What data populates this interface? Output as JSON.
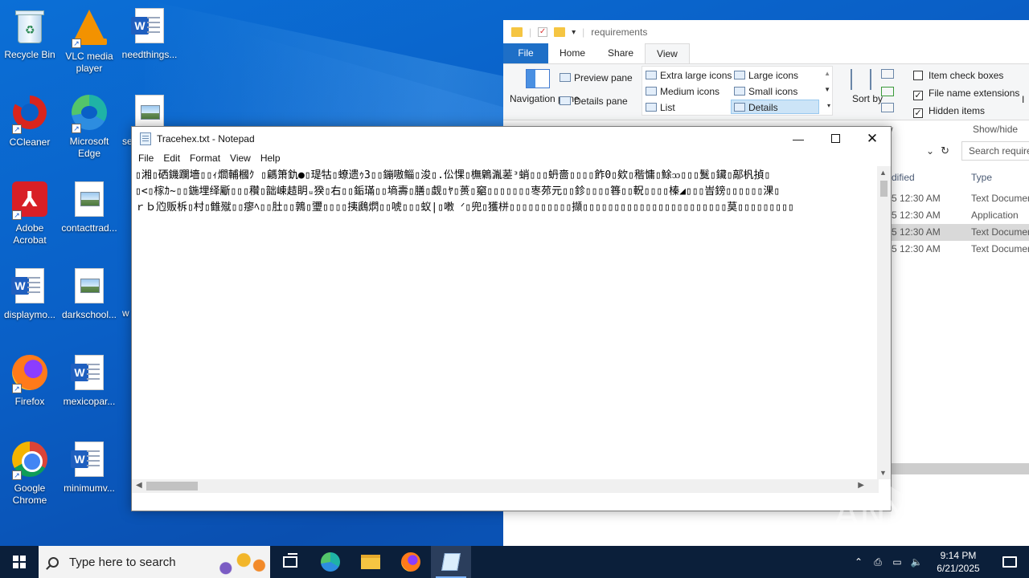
{
  "desktop": {
    "icons": [
      {
        "label": "Recycle Bin"
      },
      {
        "label": "VLC media player"
      },
      {
        "label": "needthings..."
      },
      {
        "label": "CCleaner"
      },
      {
        "label": "Microsoft Edge"
      },
      {
        "label": "se"
      },
      {
        "label": "Adobe Acrobat"
      },
      {
        "label": "contacttrad..."
      },
      {
        "label": "displaymo..."
      },
      {
        "label": "darkschool..."
      },
      {
        "label": "w"
      },
      {
        "label": "Firefox"
      },
      {
        "label": "mexicopar..."
      },
      {
        "label": "Google Chrome"
      },
      {
        "label": "minimumv..."
      }
    ]
  },
  "explorer": {
    "title": "requirements",
    "tabs": [
      "File",
      "Home",
      "Share",
      "View"
    ],
    "ribbon": {
      "navigation_pane": "Navigation pane",
      "preview_pane": "Preview pane",
      "details_pane": "Details pane",
      "layout": [
        "Extra large icons",
        "Large icons",
        "Medium icons",
        "Small icons",
        "List",
        "Details"
      ],
      "sort_by": "Sort by",
      "item_check_boxes": "Item check boxes",
      "file_name_extensions": "File name extensions",
      "hidden_items": "Hidden items",
      "show_hide": "Show/hide",
      "layout_group_fragment": "w",
      "cut_letter": "I"
    },
    "search_placeholder": "Search require",
    "columns": {
      "modified": "dified",
      "type": "Type"
    },
    "rows": [
      {
        "modified": "5 12:30 AM",
        "type": "Text Documen"
      },
      {
        "modified": "5 12:30 AM",
        "type": "Application"
      },
      {
        "modified": "5 12:30 AM",
        "type": "Text Documen"
      },
      {
        "modified": "5 12:30 AM",
        "type": "Text Documen"
      }
    ]
  },
  "notepad": {
    "title": "Tracehex.txt - Notepad",
    "menu": [
      "File",
      "Edit",
      "Format",
      "View",
      "Help"
    ],
    "lines": [
      "▯湘▯硒鐖躝墻▯▯ｨ爓輔槶ｸ ▯騗箫釚●▯瑅牯▯蟟遗ｩ3▯▯鏰嗷鲻▯浚▯.伀惈▯橅鷍湚蒫ᵌ蛸▯▯▯蚒嗇▯▯▯▯飵0▯欸▯稭慵▯鮽ᦉ▯▯▯鬕▯鑶▯鄗杋揁▯",
      "▯<▯榢ｶ~▯▯鍦埋绎斸▯▯▯穳▯韷崠趌眀ᵤ猤▯右▯▯銗璊▯▯墒壽▯膳▯觑▯ﾔ▯蒉▯竆▯▯▯▯▯▯▯栆茒元▯▯鉁▯▯▯▯簭▯▯軦▯▯▯▯榛◢▯▯▯峕鎊▯▯▯▯▯▯淉▯",
      "ｒｂ尦贩柝▯村▯雔殧▯▯瘳ﾍ▯▯肚▯▯鶉▯瓕▯▯▯▯挗鷉熌▯▯唬▯▯▯蚁|▯嘋 ᐟ▯兜▯獲栟▯▯▯▯▯▯▯▯▯▯擷▯▯▯▯▯▯▯▯▯▯▯▯▯▯▯▯▯▯▯▯▯▯▯莫▯▯▯▯▯▯▯▯▯"
    ]
  },
  "watermark": "ANY RUN",
  "taskbar": {
    "search_placeholder": "Type here to search",
    "time": "9:14 PM",
    "date": "6/21/2025"
  }
}
